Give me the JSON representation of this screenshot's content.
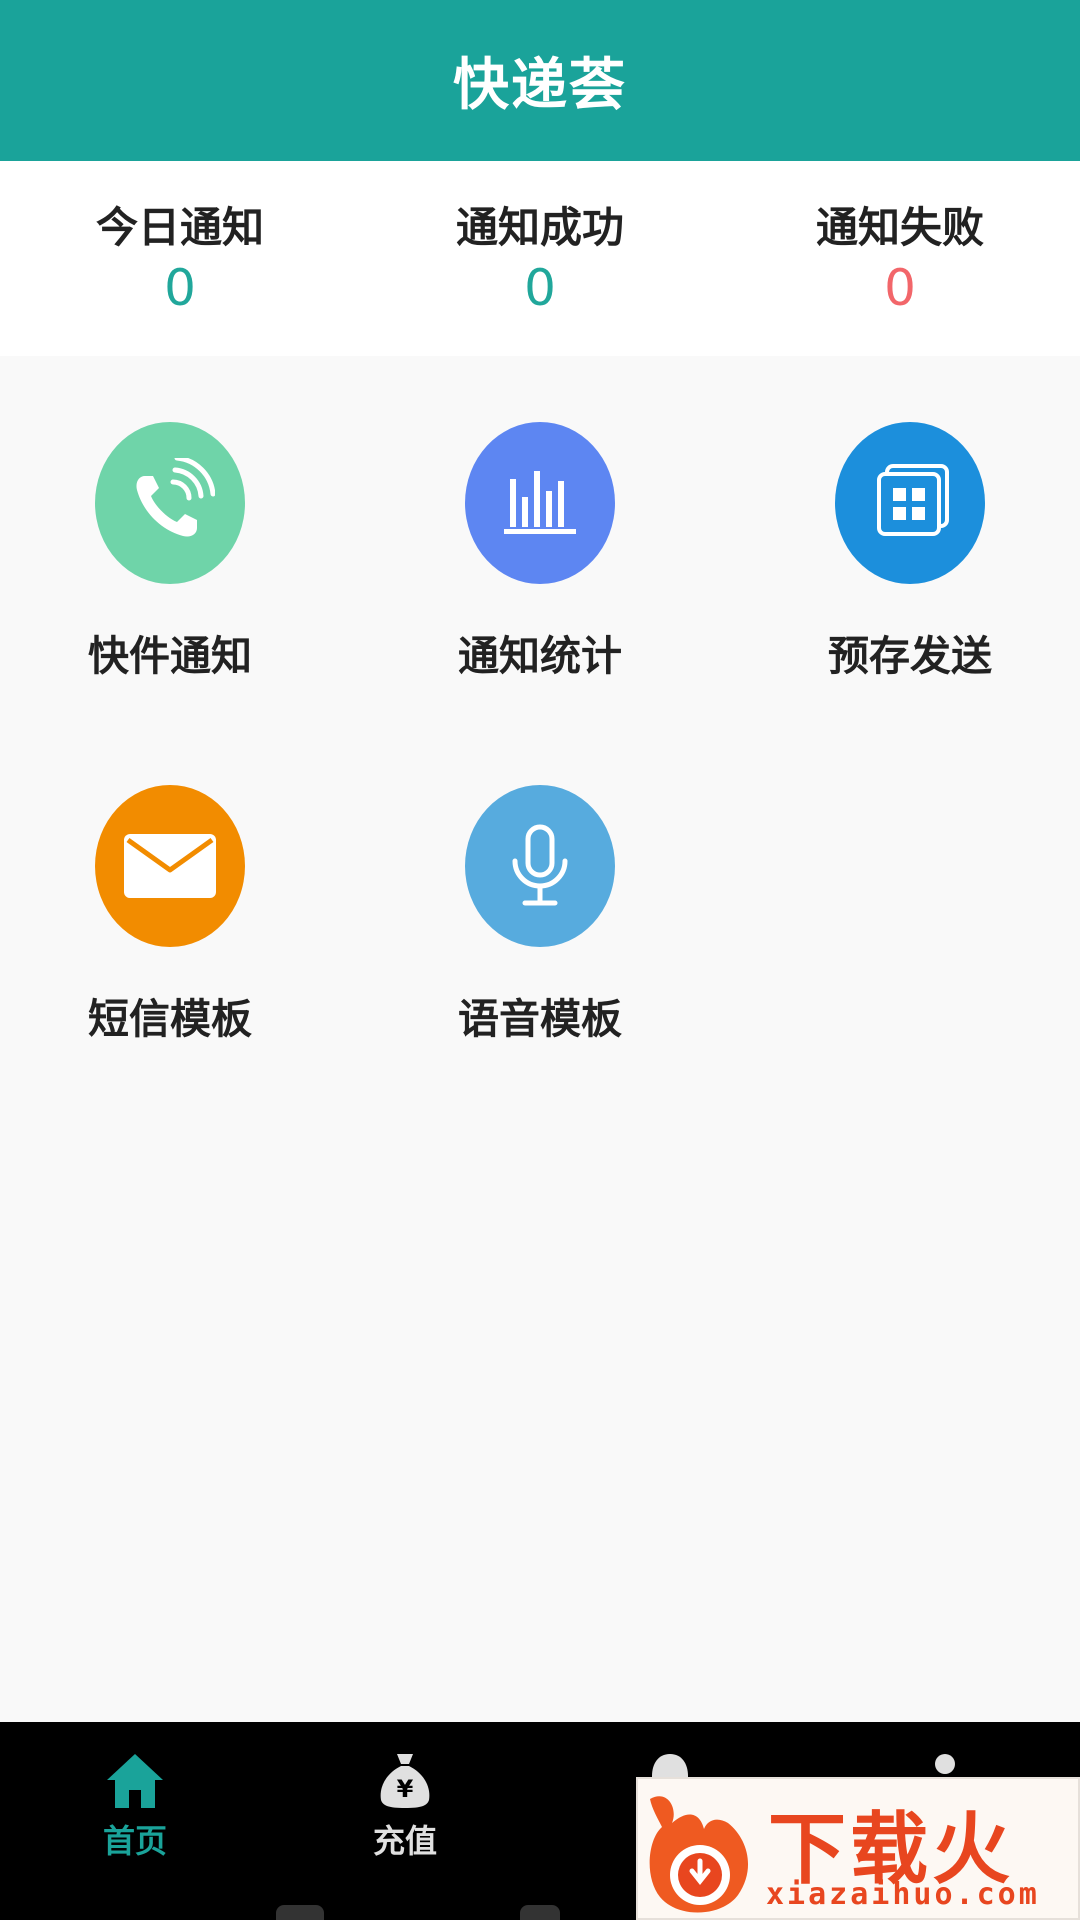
{
  "header": {
    "title": "快递荟"
  },
  "stats": [
    {
      "label": "今日通知",
      "value": "0",
      "color": "#21a79b"
    },
    {
      "label": "通知成功",
      "value": "0",
      "color": "#21a79b"
    },
    {
      "label": "通知失败",
      "value": "0",
      "color": "#f2666a"
    }
  ],
  "features": [
    {
      "label": "快件通知",
      "icon": "phone-call-icon",
      "color": "#6fd4a9"
    },
    {
      "label": "通知统计",
      "icon": "bar-chart-icon",
      "color": "#5d86f2"
    },
    {
      "label": "预存发送",
      "icon": "grid-stack-icon",
      "color": "#1c8fdc"
    },
    {
      "label": "短信模板",
      "icon": "envelope-icon",
      "color": "#f28c00"
    },
    {
      "label": "语音模板",
      "icon": "microphone-icon",
      "color": "#57abde"
    }
  ],
  "nav": {
    "items": [
      {
        "label": "首页",
        "icon": "home-icon",
        "active": true
      },
      {
        "label": "充值",
        "icon": "money-bag-icon",
        "active": false
      }
    ],
    "active_color": "#1aa39a",
    "inactive_color": "#e0e0e0"
  },
  "watermark": {
    "cn": "下载火",
    "en": "xiazaihuo.com"
  },
  "colors": {
    "header_bg": "#1aa39a",
    "page_bg": "#f9f9f9",
    "nav_bg": "#000000"
  }
}
